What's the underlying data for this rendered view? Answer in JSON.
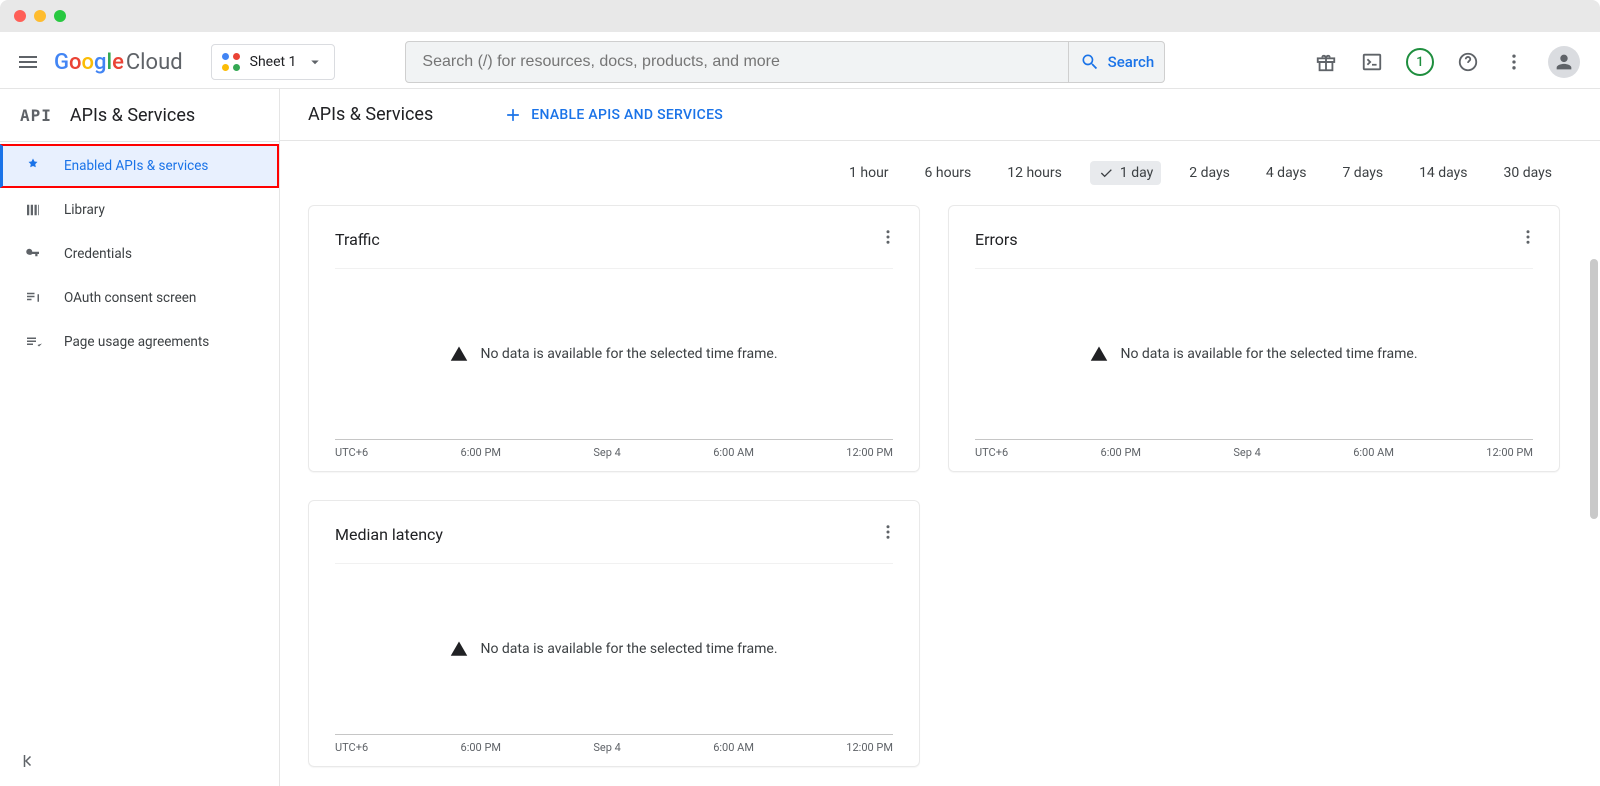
{
  "header": {
    "brand_prefix_letters": [
      "G",
      "o",
      "o",
      "g",
      "l",
      "e"
    ],
    "brand_suffix": " Cloud",
    "project_name": "Sheet 1",
    "search_placeholder": "Search (/) for resources, docs, products, and more",
    "search_button": "Search",
    "notification_count": "1"
  },
  "sidebar": {
    "section_title": "APIs & Services",
    "items": [
      {
        "icon": "enabled",
        "label": "Enabled APIs & services",
        "active": true
      },
      {
        "icon": "library",
        "label": "Library"
      },
      {
        "icon": "credentials",
        "label": "Credentials"
      },
      {
        "icon": "oauth",
        "label": "OAuth consent screen"
      },
      {
        "icon": "page-usage",
        "label": "Page usage agreements"
      }
    ]
  },
  "main": {
    "title": "APIs & Services",
    "enable_button": "ENABLE APIS AND SERVICES",
    "time_ranges": [
      "1 hour",
      "6 hours",
      "12 hours",
      "1 day",
      "2 days",
      "4 days",
      "7 days",
      "14 days",
      "30 days"
    ],
    "selected_range": "1 day",
    "cards": [
      {
        "title": "Traffic",
        "no_data_msg": "No data is available for the selected time frame.",
        "axis": [
          "UTC+6",
          "6:00 PM",
          "Sep 4",
          "6:00 AM",
          "12:00 PM"
        ]
      },
      {
        "title": "Errors",
        "no_data_msg": "No data is available for the selected time frame.",
        "axis": [
          "UTC+6",
          "6:00 PM",
          "Sep 4",
          "6:00 AM",
          "12:00 PM"
        ]
      },
      {
        "title": "Median latency",
        "no_data_msg": "No data is available for the selected time frame.",
        "axis": [
          "UTC+6",
          "6:00 PM",
          "Sep 4",
          "6:00 AM",
          "12:00 PM"
        ]
      }
    ]
  }
}
